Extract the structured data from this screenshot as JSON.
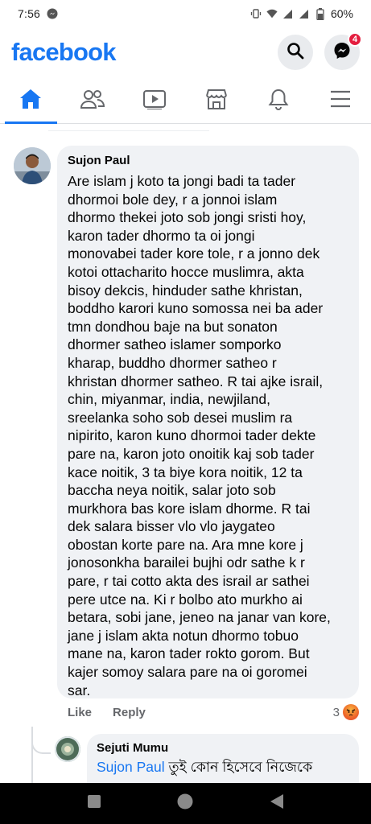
{
  "status_bar": {
    "time": "7:56",
    "battery": "60%",
    "icons": [
      "messenger-bubble-icon",
      "vibrate-icon",
      "wifi-icon",
      "signal-icon",
      "signal-icon",
      "battery-icon"
    ]
  },
  "header": {
    "logo": "facebook",
    "buttons": [
      {
        "icon": "search-icon"
      },
      {
        "icon": "messenger-icon",
        "badge": "4"
      }
    ]
  },
  "tabs": [
    {
      "icon": "home-icon",
      "active": true
    },
    {
      "icon": "friends-icon",
      "active": false
    },
    {
      "icon": "watch-icon",
      "active": false
    },
    {
      "icon": "marketplace-icon",
      "active": false
    },
    {
      "icon": "notifications-icon",
      "active": false
    },
    {
      "icon": "menu-icon",
      "active": false
    }
  ],
  "comment": {
    "author": "Sujon Paul",
    "text": "Are islam j koto ta jongi badi ta tader\ndhormoi bole dey, r a jonnoi islam\ndhormo thekei joto sob jongi sristi hoy,\nkaron tader dhormo ta oi jongi\nmonovabei tader kore tole, r a jonno dek\nkotoi ottacharito hocce muslimra, akta\nbisoy dekcis, hinduder sathe khristan,\nboddho karori kuno somossa nei ba ader\ntmn dondhou baje na but sonaton\ndhormer satheo islamer somporko\nkharap, buddho dhormer satheo r\nkhristan dhormer satheo. R tai ajke israil,\nchin, miyanmar, india, newjiland,\nsreelanka soho sob desei muslim ra\nnipirito, karon kuno dhormoi tader dekte\npare na, karon joto onoitik kaj sob tader\nkace noitik, 3 ta biye kora noitik, 12 ta\nbaccha neya noitik, salar joto sob\nmurkhora bas kore islam dhorme. R tai\ndek salara bisser vlo vlo jaygateo\nobostan korte pare na. Ara mne kore j\njonosonkha barailei bujhi odr sathe k r\npare, r tai cotto akta des israil ar sathei\npere utce na. Ki r bolbo ato murkho ai\nbetara, sobi jane, jeneo na janar van kore,\njane j islam akta notun dhormo tobuo\nmane na, karon tader rokto gorom. But\nkajer somoy salara pare na oi goromei\nsar.",
    "like_label": "Like",
    "reply_label": "Reply",
    "reaction_count": "3"
  },
  "reply": {
    "author": "Sejuti Mumu",
    "mention": "Sujon Paul",
    "text": " তুই কোন হিসেবে নিজেকে"
  },
  "nav_bar": {
    "buttons": [
      "recents-icon",
      "home-circle-icon",
      "back-triangle-icon"
    ]
  },
  "colors": {
    "brand": "#1877f2",
    "bubble": "#f0f2f5",
    "muted": "#65676b",
    "badge": "#e41e3f"
  }
}
